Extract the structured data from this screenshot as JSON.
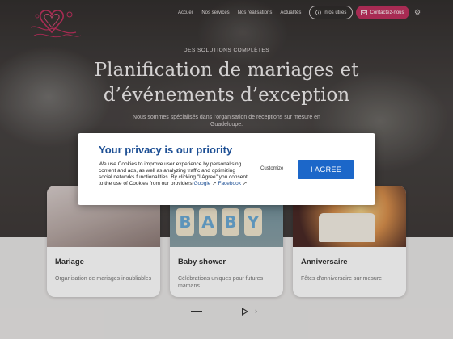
{
  "nav": {
    "items": [
      "Accueil",
      "Nos services",
      "Nos réalisations",
      "Actualités"
    ],
    "info_button": "Infos utiles",
    "contact_button": "Contactez-nous"
  },
  "hero": {
    "eyebrow": "DES SOLUTIONS COMPLÈTES",
    "headline_line1": "Planification de mariages et",
    "headline_line2": "d’événements d’exception",
    "subline": "Nous sommes spécialisés dans l’organisation de réceptions sur mesure en Guadeloupe."
  },
  "cards": [
    {
      "title": "Mariage",
      "description": "Organisation de mariages inoubliables"
    },
    {
      "title": "Baby shower",
      "description": "Célébrations uniques pour futures mamans",
      "image_letters": [
        "B",
        "A",
        "B",
        "Y"
      ]
    },
    {
      "title": "Anniversaire",
      "description": "Fêtes d’anniversaire sur mesure"
    }
  ],
  "cookie_modal": {
    "title": "Your privacy is our priority",
    "text": "We use Cookies to improve user experience by personalising content and ads, as well as analyzing traffic and optimizing social networks functionalities. By clicking \"I Agree\" you consent to the use of Cookies from our providers",
    "link_google": "Google",
    "link_facebook": "Facebook",
    "customize_label": "Customize",
    "agree_label": "I AGREE"
  },
  "colors": {
    "brand": "#c0325f",
    "modal_title": "#1d4f94",
    "agree_button": "#1c67c9"
  },
  "icons": {
    "logo": "heart-flourish-logo",
    "info": "info-circle-icon",
    "contact": "envelope-icon",
    "settings": "gear-icon",
    "slider_play": "play-icon",
    "slider_next": "chevron-right-icon",
    "external_link": "external-link-icon"
  }
}
